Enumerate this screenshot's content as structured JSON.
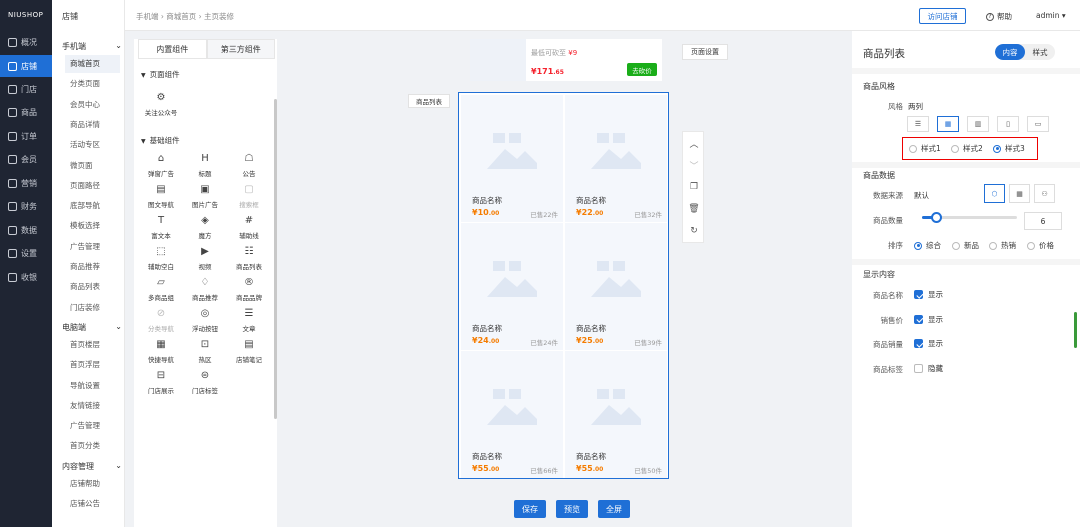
{
  "nav": {
    "logo": "NIUSHOP",
    "items": [
      {
        "label": "概况",
        "icon": "dashboard-icon"
      },
      {
        "label": "店铺",
        "icon": "shop-icon",
        "active": true
      },
      {
        "label": "门店",
        "icon": "store-icon"
      },
      {
        "label": "商品",
        "icon": "goods-icon"
      },
      {
        "label": "订单",
        "icon": "order-icon"
      },
      {
        "label": "会员",
        "icon": "member-icon"
      },
      {
        "label": "营销",
        "icon": "marketing-icon"
      },
      {
        "label": "财务",
        "icon": "finance-icon"
      },
      {
        "label": "数据",
        "icon": "data-icon"
      },
      {
        "label": "设置",
        "icon": "settings-icon"
      },
      {
        "label": "收银",
        "icon": "cashier-icon"
      }
    ]
  },
  "sidebar": {
    "header": "店铺",
    "groups": [
      {
        "label": "手机端",
        "items": [
          "商城首页",
          "分类页面",
          "会员中心",
          "商品详情",
          "活动专区",
          "微页面",
          "页面路径",
          "底部导航",
          "模板选择",
          "广告管理",
          "商品推荐",
          "商品列表",
          "门店装修"
        ]
      },
      {
        "label": "电脑端",
        "items": [
          "首页楼层",
          "首页浮层",
          "导航设置",
          "友情链接",
          "广告管理",
          "首页分类"
        ]
      },
      {
        "label": "内容管理",
        "items": [
          "店铺帮助",
          "店铺公告"
        ]
      }
    ],
    "selected": "商城首页"
  },
  "topbar": {
    "breadcrumb": "手机端 › 商城首页 › 主页装修",
    "visit_store": "访问店铺",
    "help": "帮助",
    "user": "admin ▾"
  },
  "components": {
    "tabs": [
      "内置组件",
      "第三方组件"
    ],
    "sections": [
      {
        "title": "页面组件",
        "items": [
          {
            "label": "关注公众号",
            "glyph": "⚙",
            "icon": "follow-wechat-icon"
          }
        ]
      },
      {
        "title": "基础组件",
        "items": [
          {
            "label": "弹窗广告",
            "glyph": "⌂",
            "icon": "popup-ad-icon"
          },
          {
            "label": "标题",
            "glyph": "H",
            "icon": "title-icon"
          },
          {
            "label": "公告",
            "glyph": "☖",
            "icon": "notice-icon"
          },
          {
            "label": "图文导航",
            "glyph": "▤",
            "icon": "graphic-nav-icon"
          },
          {
            "label": "图片广告",
            "glyph": "▣",
            "icon": "image-ad-icon"
          },
          {
            "label": "搜索框",
            "glyph": "▢",
            "icon": "search-box-icon",
            "dim": true
          },
          {
            "label": "富文本",
            "glyph": "T",
            "icon": "rich-text-icon"
          },
          {
            "label": "魔方",
            "glyph": "◈",
            "icon": "rubik-icon"
          },
          {
            "label": "辅助线",
            "glyph": "#",
            "icon": "guide-line-icon"
          },
          {
            "label": "辅助空白",
            "glyph": "⬚",
            "icon": "blank-icon"
          },
          {
            "label": "视频",
            "glyph": "▶",
            "icon": "video-icon"
          },
          {
            "label": "商品列表",
            "glyph": "☷",
            "icon": "goods-list-icon"
          },
          {
            "label": "多商品组",
            "glyph": "▱",
            "icon": "multi-goods-icon"
          },
          {
            "label": "商品推荐",
            "glyph": "♢",
            "icon": "goods-recommend-icon"
          },
          {
            "label": "商品品牌",
            "glyph": "®",
            "icon": "brand-icon"
          },
          {
            "label": "分类导航",
            "glyph": "⊘",
            "icon": "category-nav-icon",
            "dim": true
          },
          {
            "label": "浮动按钮",
            "glyph": "◎",
            "icon": "float-button-icon"
          },
          {
            "label": "文章",
            "glyph": "☰",
            "icon": "article-icon"
          },
          {
            "label": "快捷导航",
            "glyph": "▦",
            "icon": "quick-nav-icon"
          },
          {
            "label": "热区",
            "glyph": "⊡",
            "icon": "hotspot-icon"
          },
          {
            "label": "店铺笔记",
            "glyph": "▤",
            "icon": "store-note-icon"
          },
          {
            "label": "门店展示",
            "glyph": "⊟",
            "icon": "store-display-icon"
          },
          {
            "label": "门店标签",
            "glyph": "⊜",
            "icon": "store-tag-icon"
          }
        ]
      }
    ]
  },
  "canvas": {
    "page_settings": "页面设置",
    "list_label": "商品列表",
    "top_card": {
      "min_label": "最低可砍至",
      "min_price": "¥9",
      "price_main": "¥171",
      "price_cents": ".65",
      "buy": "去砍价"
    },
    "goods": [
      {
        "name": "商品名称",
        "price": "¥10",
        "cents": ".00",
        "sold": "已售22件"
      },
      {
        "name": "商品名称",
        "price": "¥22",
        "cents": ".00",
        "sold": "已售32件"
      },
      {
        "name": "商品名称",
        "price": "¥24",
        "cents": ".00",
        "sold": "已售24件"
      },
      {
        "name": "商品名称",
        "price": "¥25",
        "cents": ".00",
        "sold": "已售39件"
      },
      {
        "name": "商品名称",
        "price": "¥55",
        "cents": ".00",
        "sold": "已售66件"
      },
      {
        "name": "商品名称",
        "price": "¥55",
        "cents": ".00",
        "sold": "已售50件"
      }
    ],
    "tools": [
      {
        "glyph": "︿",
        "icon": "move-up-icon"
      },
      {
        "glyph": "﹀",
        "icon": "move-down-icon"
      },
      {
        "glyph": "❐",
        "icon": "copy-icon"
      },
      {
        "glyph": "🗑",
        "icon": "delete-icon"
      },
      {
        "glyph": "↻",
        "icon": "reset-icon"
      }
    ]
  },
  "bottom": {
    "save": "保存",
    "preview": "预览",
    "fullscreen": "全屏"
  },
  "panel": {
    "title": "商品列表",
    "tabs": [
      "内容",
      "样式"
    ],
    "style_section": "商品风格",
    "style_label": "风格",
    "style_value": "两列",
    "style_options": [
      "1列",
      "2列",
      "3列",
      "横滑",
      "大图"
    ],
    "style_variants": [
      "样式1",
      "样式2",
      "样式3"
    ],
    "style_variant_selected": "样式3",
    "data_section": "商品数据",
    "source_label": "数据来源",
    "source_value": "默认",
    "count_label": "商品数量",
    "count_value": "6",
    "count_fraction": 0.15,
    "sort_label": "排序",
    "sort_options": [
      "综合",
      "新品",
      "热销",
      "价格"
    ],
    "sort_selected": "综合",
    "display_section": "显示内容",
    "display": [
      {
        "label": "商品名称",
        "value": "显示",
        "checked": true
      },
      {
        "label": "销售价",
        "value": "显示",
        "checked": true
      },
      {
        "label": "商品销量",
        "value": "显示",
        "checked": true
      },
      {
        "label": "商品标签",
        "value": "隐藏",
        "checked": false
      }
    ]
  }
}
